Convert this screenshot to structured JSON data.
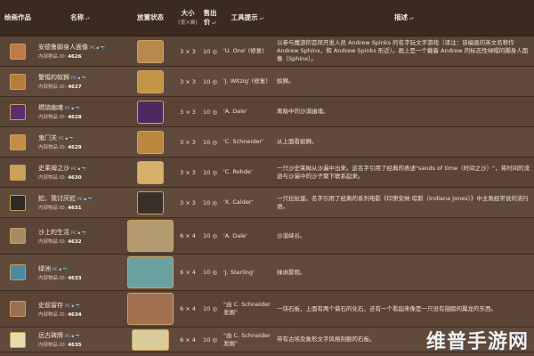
{
  "headers": {
    "image": "绘画作品",
    "name": "名称",
    "placed": "放置状态",
    "size": "大小",
    "size_sub": "(宽×高)",
    "price": "售出价",
    "tooltip": "工具提示",
    "desc": "描述"
  },
  "colors": {
    "accent_link": "#5fb2f0",
    "header_bg": "#3a2a20",
    "row_bg": "#5a4436"
  },
  "rows": [
    {
      "name": "安德鲁脚身人面像",
      "id": "4626",
      "size": "3 × 3",
      "price": "10",
      "tooltip": "'U. One' (修复)",
      "desc": "以参与魔游的首席开发人员 Andrew Spinks 的名字玩文字游戏（译注：该编画的英文名称作 Andrew Sphinx，和 Andrew Spinks 形近）。画上是一个戴着 Andrew 的标志性绿帽的脚身人面像（Sphinx）。",
      "thumb_color": "#c07a4a",
      "img_color": "#b8894f"
    },
    {
      "name": "警惕的蚁狮",
      "id": "4627",
      "size": "3 × 3",
      "price": "10",
      "tooltip": "'J. Witzig' (修复)",
      "desc": "蚁狮。",
      "thumb_color": "#b97a3e",
      "img_color": "#c49447"
    },
    {
      "name": "燃烧幽魂",
      "id": "4628",
      "size": "3 × 3",
      "price": "10",
      "tooltip": "'A. Dale'",
      "desc": "离暗中的沙漠幽魂。",
      "thumb_color": "#5a2d6e",
      "img_color": "#4b2a5f"
    },
    {
      "name": "鬼门关",
      "id": "4629",
      "size": "3 × 3",
      "price": "10",
      "tooltip": "'C. Schneider'",
      "desc": "从上面看蚁狮。",
      "thumb_color": "#c78b46",
      "img_color": "#b9883e"
    },
    {
      "name": "史莱姆之沙",
      "id": "4630",
      "size": "3 × 3",
      "price": "10",
      "tooltip": "'C. Rohde'",
      "desc": "一只沙史莱姆从沙漏中出来。这名字引用了经典的表述\"sands of time（时间之沙）\"，将时间的流逝与沙漏中的沙子聚下联系起来。",
      "thumb_color": "#caa05a",
      "img_color": "#d7b06a"
    },
    {
      "name": "蛇，我讨厌蛇",
      "id": "4631",
      "size": "3 × 3",
      "price": "10",
      "tooltip": "'X. Calder'",
      "desc": "一只拉扯蛋。名字引用了经典的系列电影《印第安纳·琼斯（Indiana Jones）》中主角经常说的流行语。",
      "thumb_color": "#2d2a27",
      "img_color": "#3a302a"
    },
    {
      "name": "沙上的生活",
      "id": "4632",
      "size": "6 × 4",
      "price": "10",
      "tooltip": "'A. Dale'",
      "desc": "沙漠峡谷。",
      "thumb_color": "#a98a62",
      "img_color": "#b49a70"
    },
    {
      "name": "绿洲",
      "id": "4633",
      "size": "6 × 4",
      "price": "10",
      "tooltip": "'J. Sterling'",
      "desc": "绿洲景观。",
      "thumb_color": "#4b8aa0",
      "img_color": "#6aa0a0"
    },
    {
      "name": "史前留存",
      "id": "4634",
      "size": "6 × 4",
      "price": "10",
      "tooltip": "\"由 C. Schneider 发掘\"",
      "desc": "一块石板，上面有两个菊石的化石，还有一个看起来像是一只没有翅膀的翼龙的东西。",
      "thumb_color": "#9a7050",
      "img_color": "#a07050"
    },
    {
      "name": "远古碑牌",
      "id": "4635",
      "size": "6 × 4",
      "price": "10",
      "tooltip": "\"由 C. Schneider 发掘\"",
      "desc": "带有古埃及象形文字风格刻痕的石板。",
      "thumb_color": "#e6dcae",
      "img_color": "#d9cc9a"
    }
  ],
  "labels": {
    "internal": "内部物品 ID",
    "tag": "PC ▪ 📷",
    "coin": "◎"
  },
  "watermark": "维普手游网"
}
